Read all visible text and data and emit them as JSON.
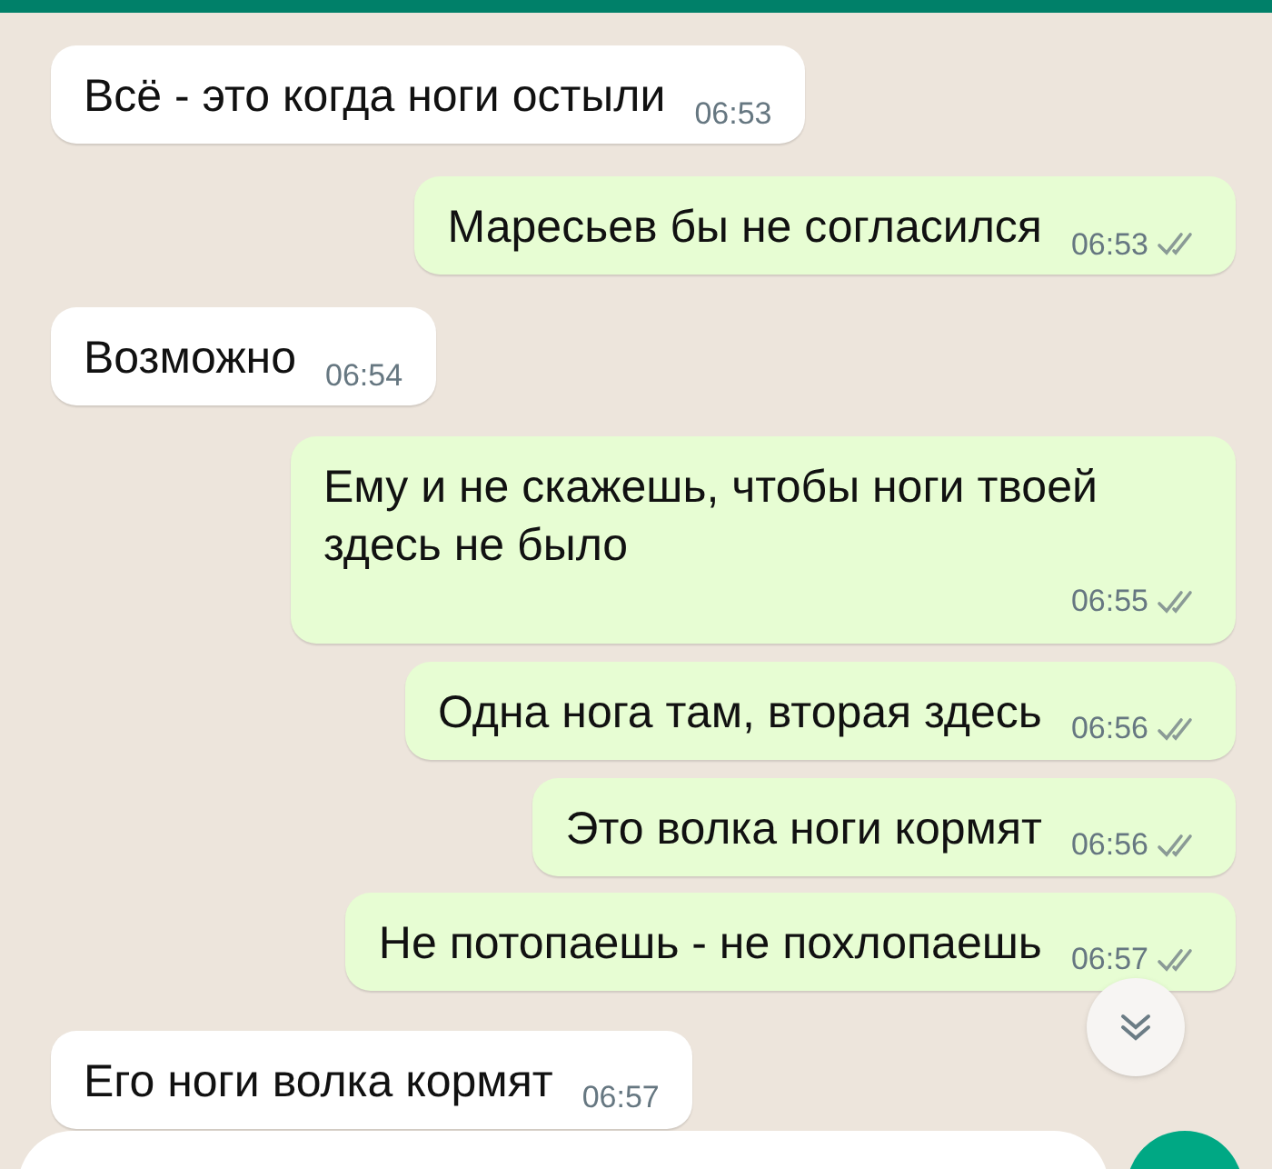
{
  "messages": [
    {
      "outgoing": false,
      "text": "Всё - это когда ноги остыли",
      "time": "06:53"
    },
    {
      "outgoing": true,
      "text": "Маресьев бы не согласился",
      "time": "06:53",
      "read": false
    },
    {
      "outgoing": false,
      "text": "Возможно",
      "time": "06:54"
    },
    {
      "outgoing": true,
      "text": "Ему и не скажешь, чтобы ноги твоей здесь не было",
      "time": "06:55",
      "read": false
    },
    {
      "outgoing": true,
      "text": "Одна нога там, вторая здесь",
      "time": "06:56",
      "read": false
    },
    {
      "outgoing": true,
      "text": "Это волка ноги кормят",
      "time": "06:56",
      "read": false
    },
    {
      "outgoing": true,
      "text": "Не потопаешь - не похлопаешь",
      "time": "06:57",
      "read": false
    },
    {
      "outgoing": false,
      "text": "Его ноги волка кормят",
      "time": "06:57"
    }
  ]
}
